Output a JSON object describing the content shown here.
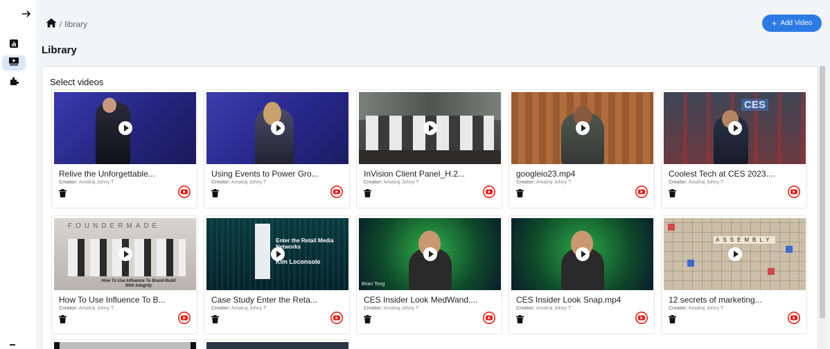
{
  "sidebar": {
    "items": [
      {
        "icon": "bar-chart-icon",
        "active": false
      },
      {
        "icon": "video-library-icon",
        "active": true
      },
      {
        "icon": "puzzle-icon",
        "active": false
      }
    ]
  },
  "breadcrumb": {
    "current": "library"
  },
  "page": {
    "title": "Library",
    "add_button": "Add Video",
    "select_label": "Select videos"
  },
  "colors": {
    "accent": "#2c7be5",
    "youtube": "#e62117"
  },
  "videos": [
    {
      "title": "Relive the Unforgettable...",
      "creator_label": "Creator:",
      "creator": "Amalraj Johny T"
    },
    {
      "title": "Using Events to Power Gro...",
      "creator_label": "Creator:",
      "creator": "Amalraj Johny T"
    },
    {
      "title": "InVision Client Panel_H.2...",
      "creator_label": "Creator:",
      "creator": "Amalraj Johny T"
    },
    {
      "title": "googleio23.mp4",
      "creator_label": "Creator:",
      "creator": "Amalraj Johny T"
    },
    {
      "title": "Coolest Tech at CES 2023....",
      "creator_label": "Creator:",
      "creator": "Amalraj Johny T",
      "thumb_text": "CES"
    },
    {
      "title": "How To Use Influence To B...",
      "creator_label": "Creator:",
      "creator": "Amalraj Johny T",
      "thumb_text": "FOUNDERMADE",
      "thumb_sub": "How To Use Influence To Brand-Build With Integrity"
    },
    {
      "title": "Case Study Enter the Reta...",
      "creator_label": "Creator:",
      "creator": "Amalraj Johny T",
      "thumb_text": "Enter the Retail Media Networks",
      "thumb_sub": "Kim Loconsole"
    },
    {
      "title": "CES Insider Look MedWand....",
      "creator_label": "Creator:",
      "creator": "Amalraj Johny T",
      "thumb_sub": "Brian Tong"
    },
    {
      "title": "CES Insider Look Snap.mp4",
      "creator_label": "Creator:",
      "creator": "Amalraj Johny T"
    },
    {
      "title": "12 secrets of marketing...",
      "creator_label": "Creator:",
      "creator": "Amalraj Johny T",
      "thumb_text": "ASSEMBLY"
    }
  ]
}
